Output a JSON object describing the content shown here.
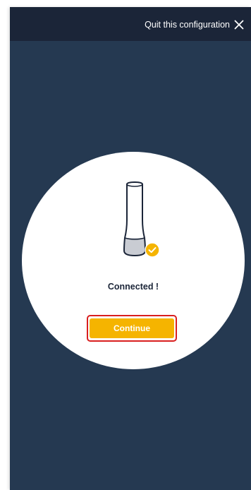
{
  "header": {
    "quit_label": "Quit this configuration",
    "close_icon": "close-icon"
  },
  "main": {
    "device_icon": "speaker-device-icon",
    "check_icon": "check-badge-icon",
    "status_text": "Connected !",
    "continue_label": "Continue"
  },
  "colors": {
    "background": "#253951",
    "topbar": "#1b2538",
    "accent": "#f5b400",
    "highlight": "#d91f1f"
  }
}
